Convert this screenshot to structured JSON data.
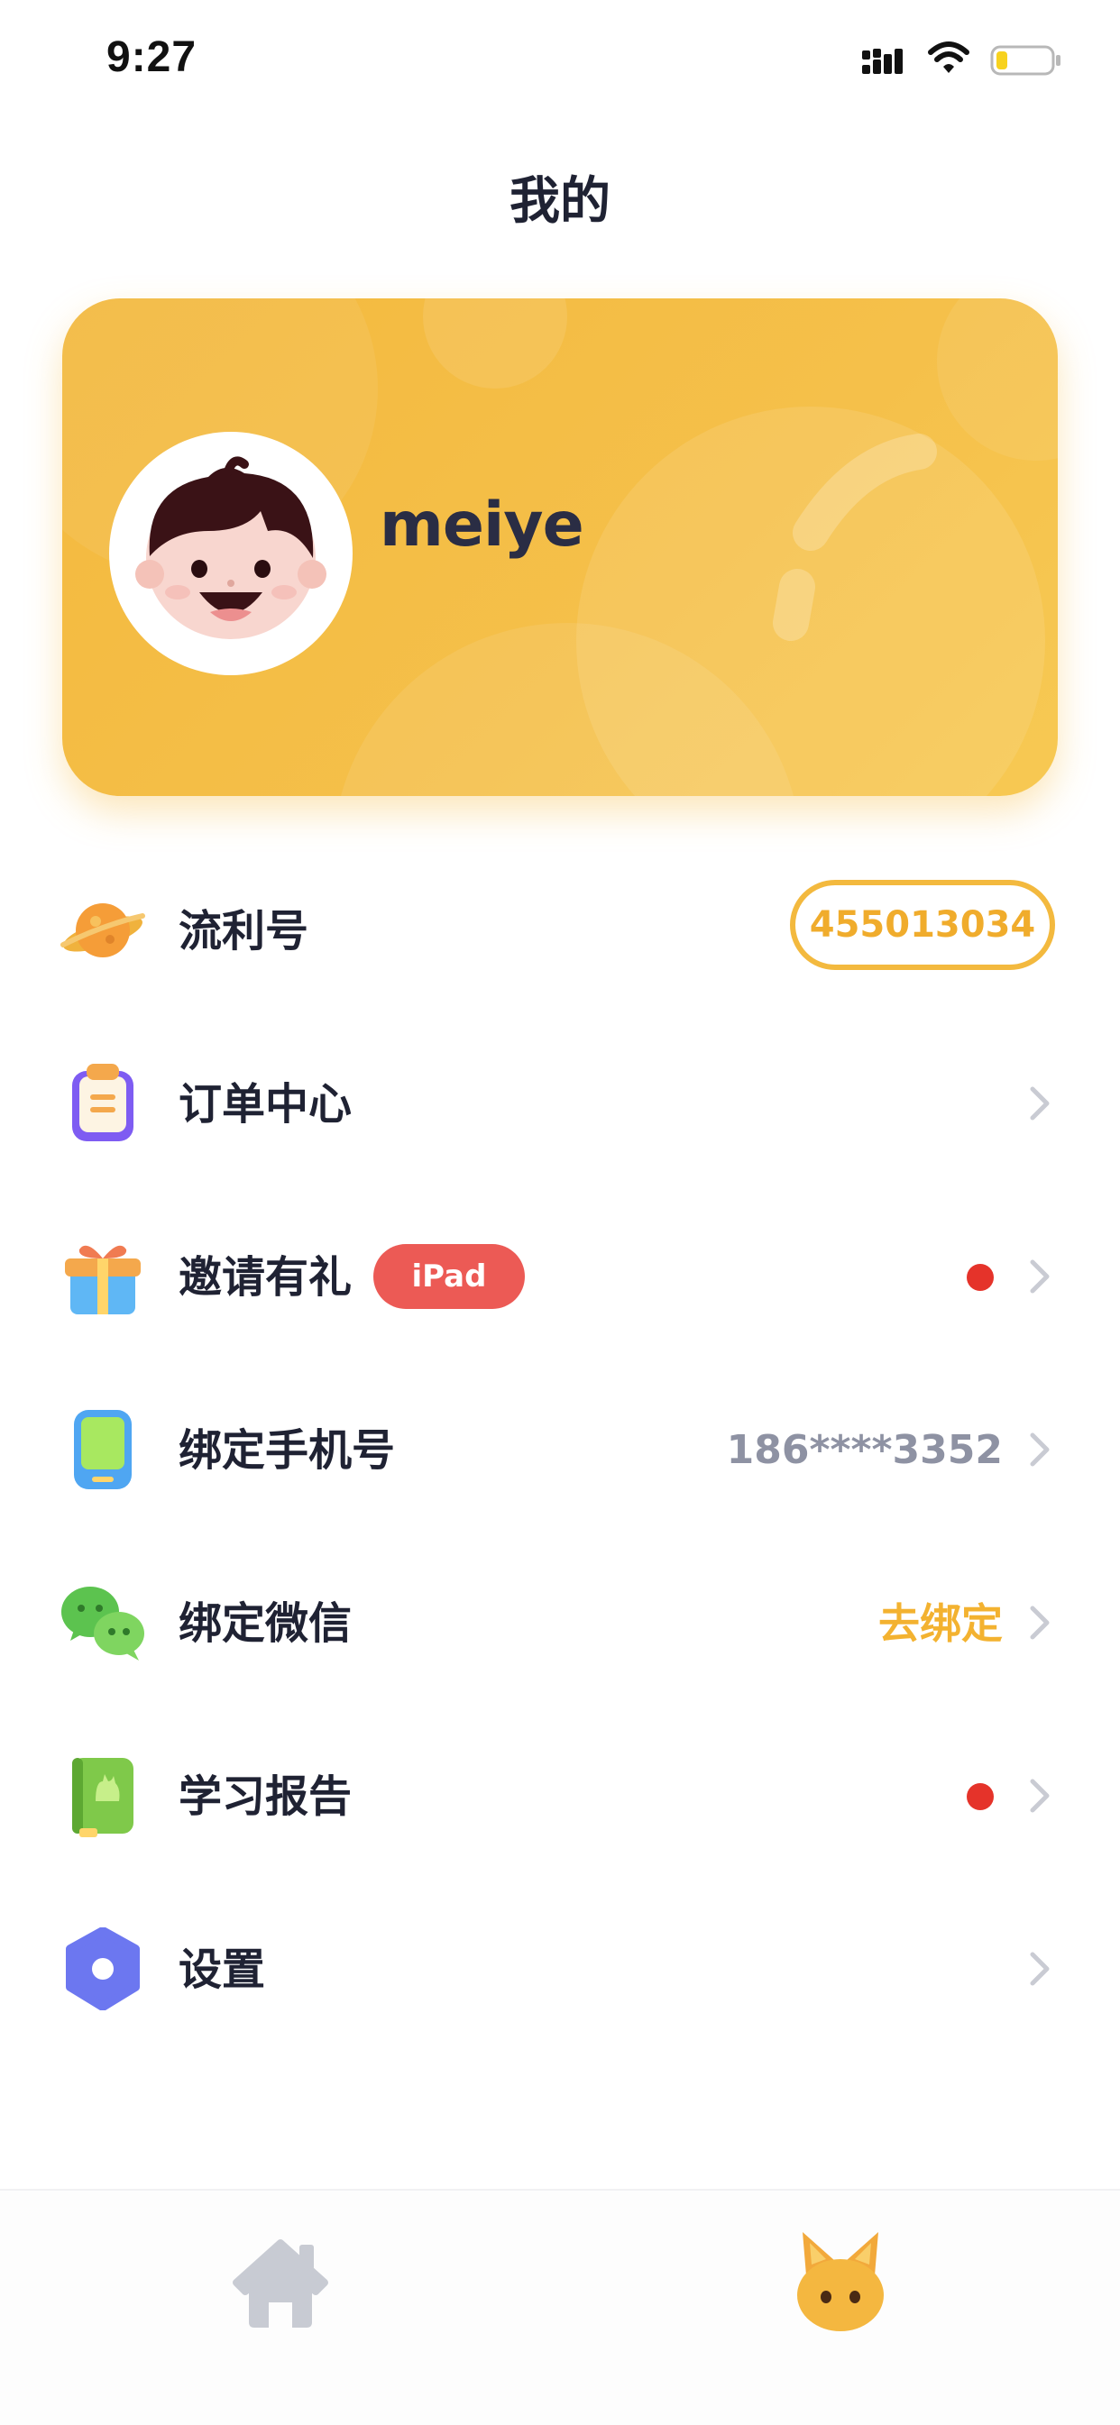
{
  "status_bar": {
    "time": "9:27",
    "icons": [
      "signal-icon",
      "wifi-icon",
      "battery-icon"
    ]
  },
  "page": {
    "title": "我的"
  },
  "profile": {
    "username": "meiye",
    "avatar": "boy-avatar",
    "card_color": "#f3b93e"
  },
  "menu": {
    "items": [
      {
        "label": "流利号",
        "icon": "planet-icon",
        "value": "455013034"
      },
      {
        "label": "订单中心",
        "icon": "order-clipboard-icon"
      },
      {
        "label": "邀请有礼",
        "icon": "gift-icon",
        "badge": "iPad",
        "has_dot": true
      },
      {
        "label": "绑定手机号",
        "icon": "phone-icon",
        "value": "186****3352"
      },
      {
        "label": "绑定微信",
        "icon": "wechat-icon",
        "value": "去绑定"
      },
      {
        "label": "学习报告",
        "icon": "report-book-icon",
        "has_dot": true
      },
      {
        "label": "设置",
        "icon": "settings-icon"
      }
    ]
  },
  "tab_bar": {
    "tabs": [
      {
        "name": "home-tab",
        "icon": "home-icon",
        "active": false
      },
      {
        "name": "mine-tab",
        "icon": "fox-mascot-icon",
        "active": true
      }
    ]
  },
  "colors": {
    "accent": "#f3b93e",
    "red_dot": "#e5332a",
    "badge": "#ec5a55",
    "text": "#1f2233",
    "muted": "#8e92a3"
  }
}
